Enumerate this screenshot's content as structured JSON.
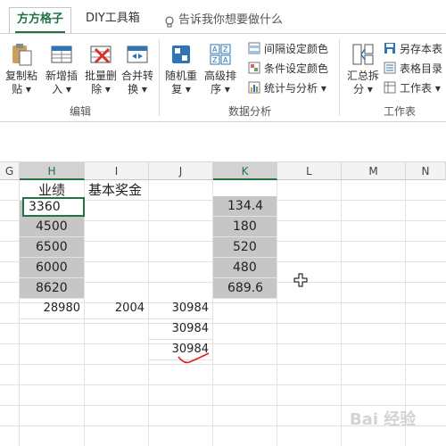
{
  "tabs": {
    "active": "方方格子",
    "diy": "DIY工具箱",
    "tell_me": "告诉我你想要做什么"
  },
  "ribbon": {
    "edit_group": {
      "label": "编辑",
      "buttons": [
        {
          "line1": "复制粘",
          "line2": "贴 ▾"
        },
        {
          "line1": "新增插",
          "line2": "入 ▾"
        },
        {
          "line1": "批量删",
          "line2": "除 ▾"
        },
        {
          "line1": "合并转",
          "line2": "换 ▾"
        }
      ]
    },
    "analysis_group": {
      "label": "数据分析",
      "buttons": [
        {
          "line1": "随机重",
          "line2": "复 ▾"
        },
        {
          "line1": "高级排",
          "line2": "序 ▾"
        }
      ],
      "small": [
        "间隔设定颜色",
        "条件设定颜色",
        "统计与分析 ▾"
      ]
    },
    "sheet_group": {
      "label": "工作表",
      "button": {
        "line1": "汇总拆",
        "line2": "分 ▾"
      },
      "small": [
        "另存本表",
        "表格目录",
        "工作表 ▾"
      ]
    }
  },
  "columns": [
    "G",
    "H",
    "I",
    "J",
    "K",
    "L",
    "M",
    "N"
  ],
  "cells": {
    "h_header": "业绩",
    "i_header": "基本奖金",
    "h_values": [
      "3360",
      "4500",
      "6500",
      "6000",
      "8620"
    ],
    "k_values": [
      "134.4",
      "180",
      "520",
      "480",
      "689.6"
    ],
    "sum_h": "28980",
    "sum_i": "2004",
    "j_results": [
      "30984",
      "30984",
      "30984"
    ]
  },
  "watermark": "Bai 经验"
}
